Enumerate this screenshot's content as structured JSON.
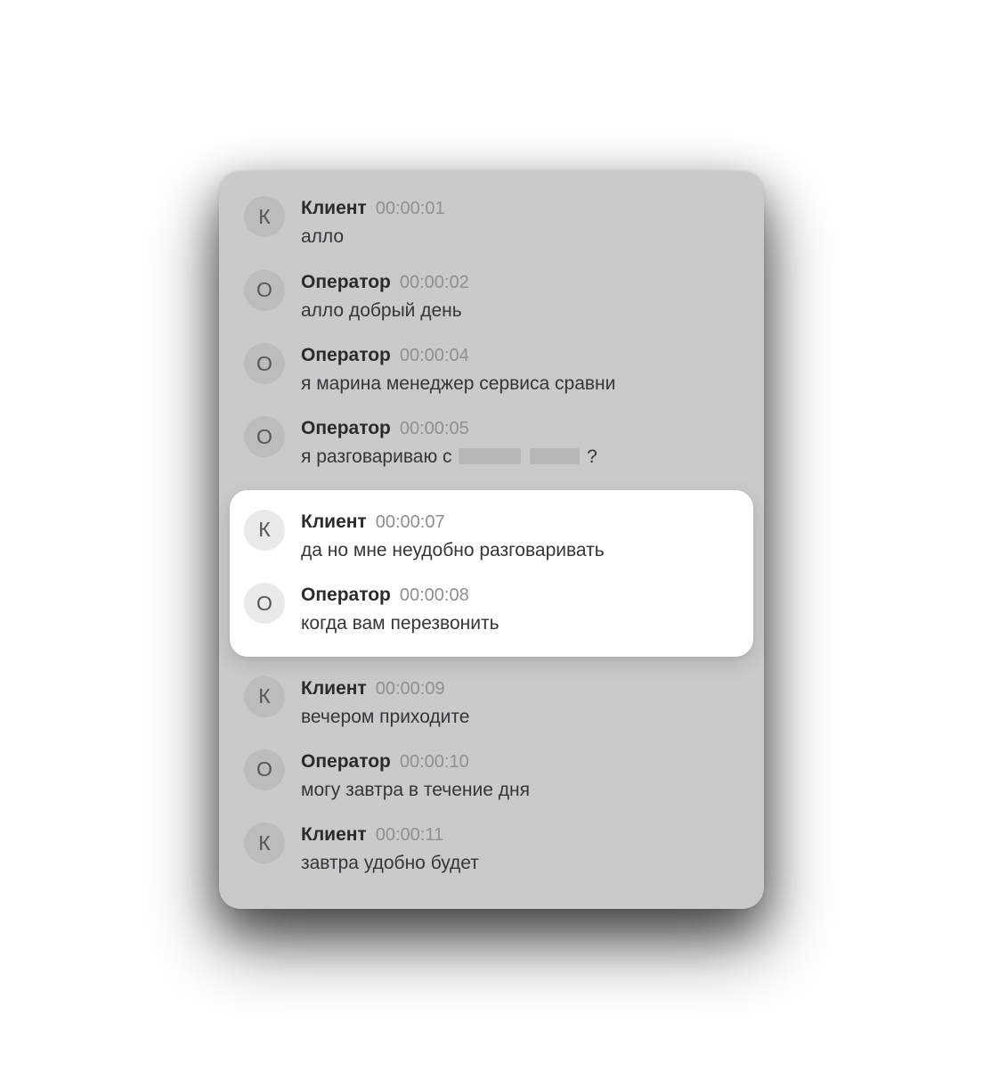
{
  "messages": [
    {
      "avatar": "К",
      "sender": "Клиент",
      "time": "00:00:01",
      "text": "алло"
    },
    {
      "avatar": "О",
      "sender": "Оператор",
      "time": "00:00:02",
      "text": "алло добрый день"
    },
    {
      "avatar": "О",
      "sender": "Оператор",
      "time": "00:00:04",
      "text": "я марина менеджер сервиса сравни"
    },
    {
      "avatar": "О",
      "sender": "Оператор",
      "time": "00:00:05",
      "text_prefix": "я разговариваю с ",
      "text_suffix": "?",
      "redacted": true
    },
    {
      "avatar": "К",
      "sender": "Клиент",
      "time": "00:00:07",
      "text": "да но мне неудобно разговаривать",
      "highlight": true
    },
    {
      "avatar": "О",
      "sender": "Оператор",
      "time": "00:00:08",
      "text": "когда вам перезвонить",
      "highlight": true
    },
    {
      "avatar": "К",
      "sender": "Клиент",
      "time": "00:00:09",
      "text": "вечером приходите"
    },
    {
      "avatar": "О",
      "sender": "Оператор",
      "time": "00:00:10",
      "text": "могу завтра в течение дня"
    },
    {
      "avatar": "К",
      "sender": "Клиент",
      "time": "00:00:11",
      "text": "завтра удобно будет"
    }
  ]
}
